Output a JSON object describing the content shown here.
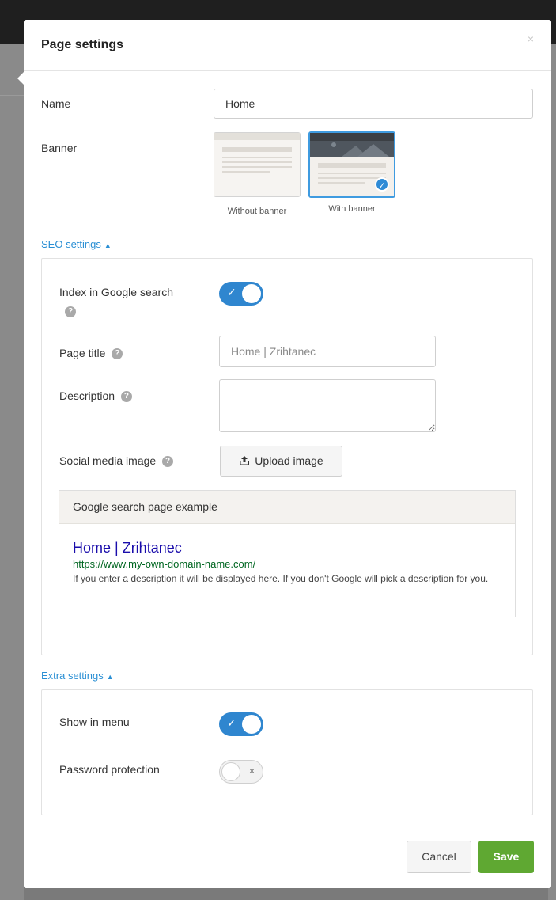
{
  "dialog": {
    "title": "Page settings",
    "close_symbol": "×"
  },
  "name": {
    "label": "Name",
    "value": "Home"
  },
  "banner": {
    "label": "Banner",
    "options": [
      {
        "caption": "Without banner",
        "selected": false
      },
      {
        "caption": "With banner",
        "selected": true
      }
    ]
  },
  "seo": {
    "toggle_label": "SEO settings",
    "index_label": "Index in Google search",
    "index_enabled": true,
    "page_title_label": "Page title",
    "page_title_placeholder": "Home | Zrihtanec",
    "description_label": "Description",
    "description_value": "",
    "social_image_label": "Social media image",
    "upload_label": "Upload image",
    "example": {
      "header": "Google search page example",
      "title": "Home | Zrihtanec",
      "url": "https://www.my-own-domain-name.com/",
      "description": "If you enter a description it will be displayed here. If you don't Google will pick a description for you."
    }
  },
  "extra": {
    "toggle_label": "Extra settings",
    "show_in_menu_label": "Show in menu",
    "show_in_menu_enabled": true,
    "password_label": "Password protection",
    "password_enabled": false
  },
  "footer": {
    "cancel_label": "Cancel",
    "save_label": "Save"
  },
  "symbols": {
    "help": "?",
    "check": "✓",
    "cross": "×",
    "triangle_up": "▲"
  },
  "colors": {
    "accent": "#2f86cf",
    "save": "#5fa832",
    "link": "#2a8fd4"
  }
}
